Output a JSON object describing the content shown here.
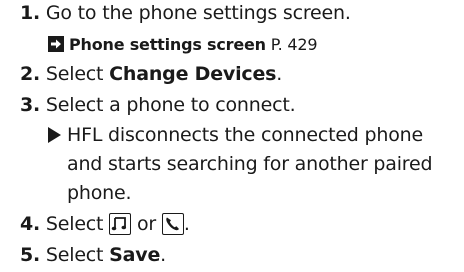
{
  "steps": [
    {
      "num": "1.",
      "text": "Go to the phone settings screen."
    },
    {
      "num": "2.",
      "pre": "Select ",
      "bold": "Change Devices",
      "post": "."
    },
    {
      "num": "3.",
      "text": "Select a phone to connect."
    },
    {
      "num": "4.",
      "pre": "Select ",
      "mid": " or ",
      "post": "."
    },
    {
      "num": "5.",
      "pre": "Select ",
      "bold": "Save",
      "post": "."
    }
  ],
  "reference": {
    "title": "Phone settings screen",
    "page": "P. 429",
    "icon": "right-arrow-box-icon"
  },
  "note": {
    "icon": "triangle-bullet-icon",
    "lines": [
      "HFL disconnects the connected phone",
      "and starts searching for another paired",
      "phone."
    ]
  },
  "icons": {
    "music": "music-note-icon",
    "phone": "phone-handset-icon"
  }
}
